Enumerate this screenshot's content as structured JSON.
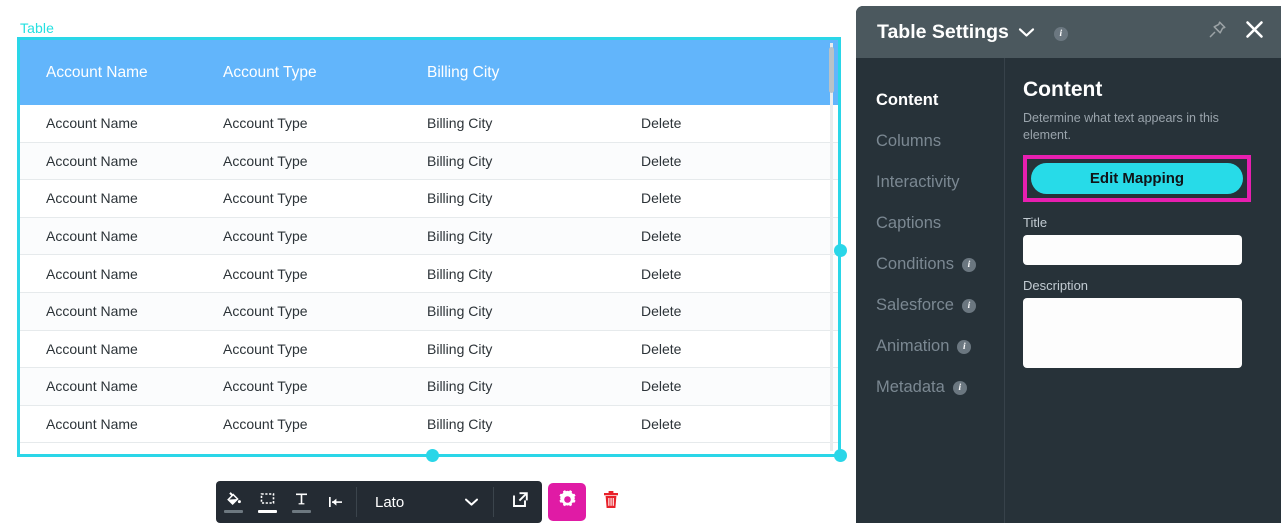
{
  "canvas": {
    "element_label": "Table",
    "table": {
      "headers": [
        "Account Name",
        "Account Type",
        "Billing City",
        ""
      ],
      "rows": [
        [
          "Account Name",
          "Account Type",
          "Billing City",
          "Delete"
        ],
        [
          "Account Name",
          "Account Type",
          "Billing City",
          "Delete"
        ],
        [
          "Account Name",
          "Account Type",
          "Billing City",
          "Delete"
        ],
        [
          "Account Name",
          "Account Type",
          "Billing City",
          "Delete"
        ],
        [
          "Account Name",
          "Account Type",
          "Billing City",
          "Delete"
        ],
        [
          "Account Name",
          "Account Type",
          "Billing City",
          "Delete"
        ],
        [
          "Account Name",
          "Account Type",
          "Billing City",
          "Delete"
        ],
        [
          "Account Name",
          "Account Type",
          "Billing City",
          "Delete"
        ],
        [
          "Account Name",
          "Account Type",
          "Billing City",
          "Delete"
        ]
      ],
      "header_bg": "#62b5fb",
      "selection_color": "#2ad6e8"
    }
  },
  "toolbar": {
    "icons": [
      {
        "name": "fill-color-icon",
        "swatch": "#6d7880"
      },
      {
        "name": "border-color-icon",
        "swatch": "#ffffff"
      },
      {
        "name": "text-color-icon",
        "swatch": "#6d7880"
      },
      {
        "name": "align-left-icon",
        "swatch": ""
      }
    ],
    "font_select": {
      "value": "Lato",
      "options": [
        "Lato"
      ]
    },
    "external_link_label": "Open",
    "settings_label": "Settings",
    "delete_label": "Delete",
    "settings_bg": "#e01ba5",
    "delete_color": "#e8212a"
  },
  "panel": {
    "title": "Table Settings",
    "header_bg": "#4b585e",
    "body_bg": "#273239",
    "nav": [
      {
        "label": "Content",
        "active": true,
        "info": false
      },
      {
        "label": "Columns",
        "active": false,
        "info": false
      },
      {
        "label": "Interactivity",
        "active": false,
        "info": false
      },
      {
        "label": "Captions",
        "active": false,
        "info": false
      },
      {
        "label": "Conditions",
        "active": false,
        "info": true
      },
      {
        "label": "Salesforce",
        "active": false,
        "info": true
      },
      {
        "label": "Animation",
        "active": false,
        "info": true
      },
      {
        "label": "Metadata",
        "active": false,
        "info": true
      }
    ],
    "content": {
      "heading": "Content",
      "description": "Determine what text appears in this element.",
      "edit_mapping_label": "Edit Mapping",
      "edit_mapping_color": "#27dbe8",
      "highlight_color": "#e81fb0",
      "title_label": "Title",
      "title_value": "",
      "description_label": "Description",
      "description_value": ""
    }
  }
}
